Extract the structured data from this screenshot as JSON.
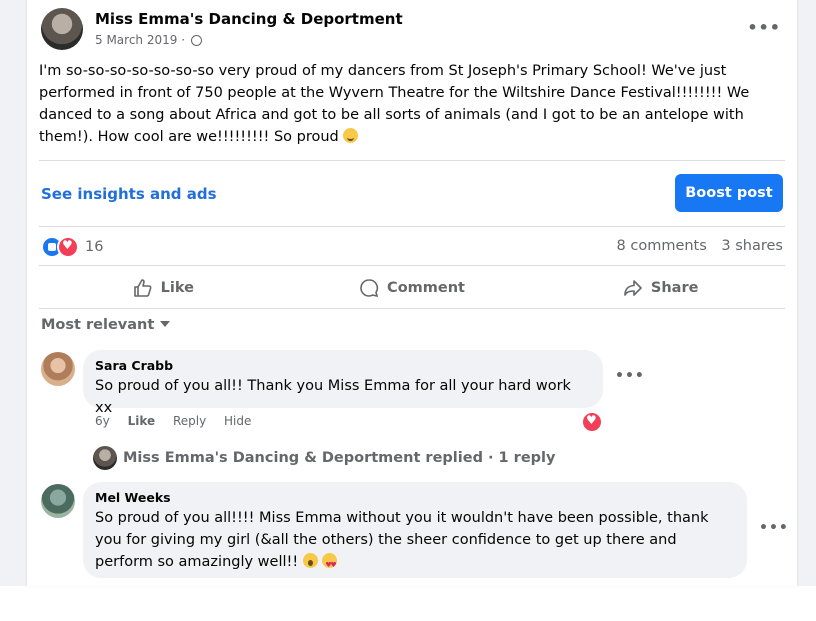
{
  "post": {
    "page_name": "Miss Emma's Dancing & Deportment",
    "date": "5 March 2019",
    "dot": "·",
    "more_icon": "more-horizontal-icon",
    "text": "I'm so-so-so-so-so-so-so very proud of my dancers from St Joseph's Primary School! We've just performed in front of 750 people at the Wyvern Theatre for the Wiltshire Dance Festival!!!!!!!! We danced to a song about Africa and got to be all sorts of animals (and I got to be an antelope with them!). How cool are we!!!!!!!!! So proud"
  },
  "insights": {
    "link": "See insights and ads",
    "boost_label": "Boost post"
  },
  "stats": {
    "reaction_count": "16",
    "comments": "8 comments",
    "shares": "3 shares"
  },
  "actions": {
    "like": "Like",
    "comment": "Comment",
    "share": "Share"
  },
  "sort": {
    "label": "Most relevant"
  },
  "comments": [
    {
      "name": "Sara Crabb",
      "text": "So proud of you all!! Thank you Miss Emma for all your hard work xx",
      "age": "6y",
      "like": "Like",
      "reply": "Reply",
      "hide": "Hide"
    },
    {
      "name": "Mel Weeks",
      "text": "So proud of you all!!!! Miss Emma without you it wouldn't have been possible, thank you for giving my girl (&all the others) the sheer confidence to get up there and perform so amazingly well!!"
    }
  ],
  "reply_summary": "Miss Emma's Dancing & Deportment replied · 1 reply",
  "colors": {
    "accent": "#1877f2",
    "link": "#216fdb",
    "love": "#f33e58",
    "muted": "#65676b",
    "bubble": "#f0f2f5"
  }
}
